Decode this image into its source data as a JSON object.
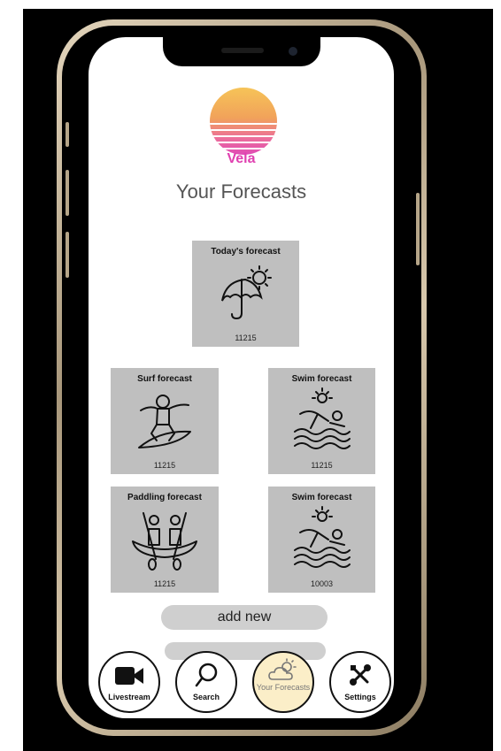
{
  "app": {
    "brand": "Vela",
    "page_title": "Your Forecasts"
  },
  "colors": {
    "brand_pink": "#e040b0",
    "card_gray": "#bfbfbf",
    "active_nav": "#fbeec8"
  },
  "cards": [
    {
      "title": "Today's forecast",
      "code": "11215",
      "icon": "umbrella-sun-icon"
    },
    {
      "title": "Surf forecast",
      "code": "11215",
      "icon": "surfer-icon"
    },
    {
      "title": "Swim forecast",
      "code": "11215",
      "icon": "swimmer-icon"
    },
    {
      "title": "Paddling forecast",
      "code": "11215",
      "icon": "canoe-icon"
    },
    {
      "title": "Swim forecast",
      "code": "10003",
      "icon": "swimmer-icon"
    }
  ],
  "actions": {
    "add_new": "add new"
  },
  "nav": [
    {
      "label": "Livestream",
      "icon": "video-camera-icon"
    },
    {
      "label": "Search",
      "icon": "magnifier-icon"
    },
    {
      "label": "Your Forecasts",
      "icon": "cloud-sun-icon",
      "active": true
    },
    {
      "label": "Settings",
      "icon": "tools-icon"
    }
  ]
}
